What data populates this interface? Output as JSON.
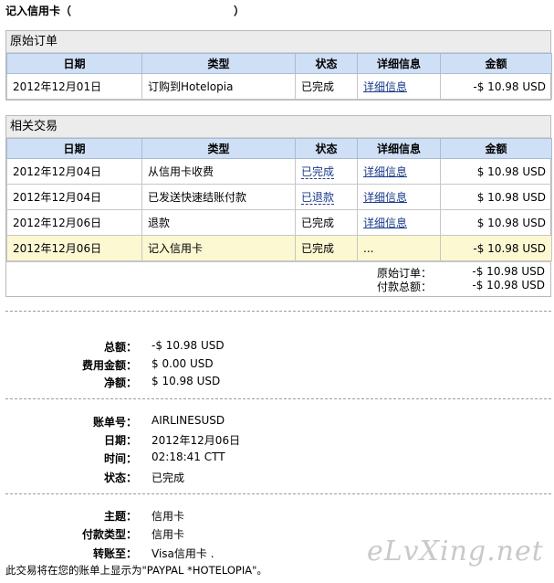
{
  "title": {
    "text": "记入信用卡",
    "open_paren": "（",
    "close_paren": "）"
  },
  "original_order": {
    "heading": "原始订单",
    "columns": [
      "日期",
      "类型",
      "状态",
      "详细信息",
      "金额"
    ],
    "rows": [
      {
        "date": "2012年12月01日",
        "type": "订购到Hotelopia",
        "status": "已完成",
        "detail": "详细信息",
        "amount": "-$ 10.98 USD"
      }
    ]
  },
  "related": {
    "heading": "相关交易",
    "columns": [
      "日期",
      "类型",
      "状态",
      "详细信息",
      "金额"
    ],
    "rows": [
      {
        "date": "2012年12月04日",
        "type": "从信用卡收费",
        "status": "已完成",
        "detail": "详细信息",
        "amount": "$ 10.98 USD"
      },
      {
        "date": "2012年12月04日",
        "type": "已发送快速结账付款",
        "status": "已退款",
        "detail": "详细信息",
        "amount": "$ 10.98 USD"
      },
      {
        "date": "2012年12月06日",
        "type": "退款",
        "status": "已完成",
        "detail": "详细信息",
        "amount": "$ 10.98 USD"
      },
      {
        "date": "2012年12月06日",
        "type": "记入信用卡",
        "status": "已完成",
        "detail": "...",
        "amount": "-$ 10.98 USD"
      }
    ],
    "totals": [
      {
        "label": "原始订单：",
        "value": "-$ 10.98 USD"
      },
      {
        "label": "付款总额：",
        "value": "-$ 10.98 USD"
      }
    ]
  },
  "amounts": [
    {
      "label": "总额：",
      "value": "-$ 10.98 USD"
    },
    {
      "label": "费用金额：",
      "value": "$ 0.00 USD"
    },
    {
      "label": "净额：",
      "value": "$ 10.98 USD"
    }
  ],
  "info": [
    {
      "label": "账单号：",
      "value": "AIRLINESUSD"
    },
    {
      "label": "日期：",
      "value": "2012年12月06日"
    },
    {
      "label": "时间：",
      "value": "02:18:41 CTT"
    },
    {
      "label": "状态：",
      "value": "已完成"
    }
  ],
  "payment": [
    {
      "label": "主题：",
      "value": "信用卡"
    },
    {
      "label": "付款类型：",
      "value": "信用卡"
    },
    {
      "label": "转账至：",
      "value": "Visa信用卡 ."
    }
  ],
  "footer_note": "此交易将在您的账单上显示为\"PAYPAL *HOTELOPIA\"。",
  "watermark": "eLvXing.net"
}
